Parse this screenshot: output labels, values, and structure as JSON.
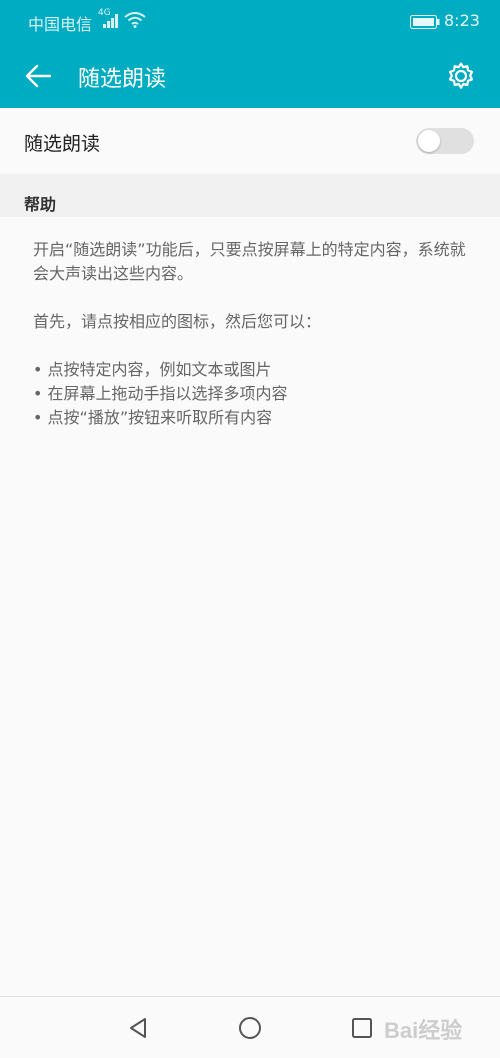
{
  "status_bar": {
    "carrier": "中国电信",
    "network": "4G",
    "time": "8:23"
  },
  "app_bar": {
    "title": "随选朗读",
    "icons": {
      "back": "back-arrow-icon",
      "settings": "gear-icon"
    }
  },
  "toggle": {
    "label": "随选朗读",
    "state": "off"
  },
  "help": {
    "header": "帮助",
    "paragraph1": "开启“随选朗读”功能后，只要点按屏幕上的特定内容，系统就会大声读出这些内容。",
    "paragraph2": "首先，请点按相应的图标，然后您可以：",
    "bullets": [
      "• 点按特定内容，例如文本或图片",
      "• 在屏幕上拖动手指以选择多项内容",
      "• 点按“播放”按钮来听取所有内容"
    ]
  },
  "nav_bar": {
    "icons": [
      "back-triangle-icon",
      "home-circle-icon",
      "recents-square-icon"
    ]
  },
  "watermark": "Bai经验",
  "colors": {
    "accent": "#00acc1",
    "switch_off": "#e0e0e0"
  }
}
